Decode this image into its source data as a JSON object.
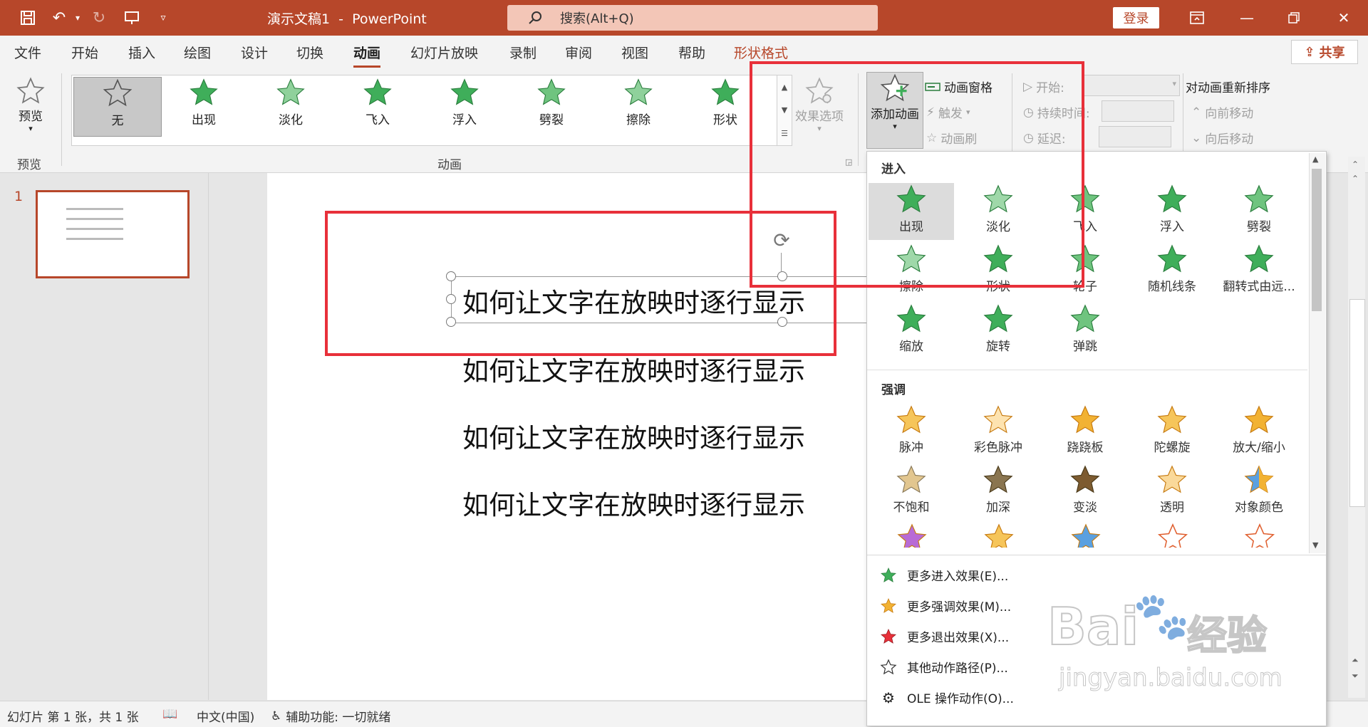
{
  "titlebar": {
    "doc_title": "演示文稿1  -  PowerPoint",
    "search_placeholder": "搜索(Alt+Q)",
    "login": "登录"
  },
  "tabs": [
    "文件",
    "开始",
    "插入",
    "绘图",
    "设计",
    "切换",
    "动画",
    "幻灯片放映",
    "录制",
    "审阅",
    "视图",
    "帮助",
    "形状格式"
  ],
  "active_tab": "动画",
  "share": "共享",
  "ribbon": {
    "preview": {
      "label": "预览",
      "group": "预览"
    },
    "animation_group": "动画",
    "gallery": [
      "无",
      "出现",
      "淡化",
      "飞入",
      "浮入",
      "劈裂",
      "擦除",
      "形状"
    ],
    "effect_options": "效果选项",
    "add_animation": "添加动画",
    "animation_pane": "动画窗格",
    "trigger": "触发",
    "animation_painter": "动画刷",
    "start": "开始:",
    "duration": "持续时间:",
    "delay": "延迟:",
    "reorder_title": "对动画重新排序",
    "move_earlier": "向前移动",
    "move_later": "向后移动"
  },
  "slide_panel": {
    "number": "1"
  },
  "slide": {
    "lines": [
      "如何让文字在放映时逐行显示",
      "如何让文字在放映时逐行显示",
      "如何让文字在放映时逐行显示",
      "如何让文字在放映时逐行显示"
    ]
  },
  "panel": {
    "enter_title": "进入",
    "enter": [
      "出现",
      "淡化",
      "飞入",
      "浮入",
      "劈裂",
      "擦除",
      "形状",
      "轮子",
      "随机线条",
      "翻转式由远...",
      "缩放",
      "旋转",
      "弹跳"
    ],
    "emphasis_title": "强调",
    "emphasis": [
      "脉冲",
      "彩色脉冲",
      "跷跷板",
      "陀螺旋",
      "放大/缩小",
      "不饱和",
      "加深",
      "变淡",
      "透明",
      "对象颜色"
    ],
    "more": [
      "更多进入效果(E)...",
      "更多强调效果(M)...",
      "更多退出效果(X)...",
      "其他动作路径(P)...",
      "OLE 操作动作(O)..."
    ]
  },
  "statusbar": {
    "slide_info": "幻灯片 第 1 张，共 1 张",
    "language": "中文(中国)",
    "accessibility": "辅助功能: 一切就绪"
  },
  "watermark": {
    "brand": "Bai",
    "brand2": "经验",
    "url": "jingyan.baidu.com"
  },
  "colors": {
    "accent": "#b7472a",
    "highlight_box": "#e8303a",
    "star_green": "#3fae5a",
    "star_gold": "#f2b233"
  }
}
